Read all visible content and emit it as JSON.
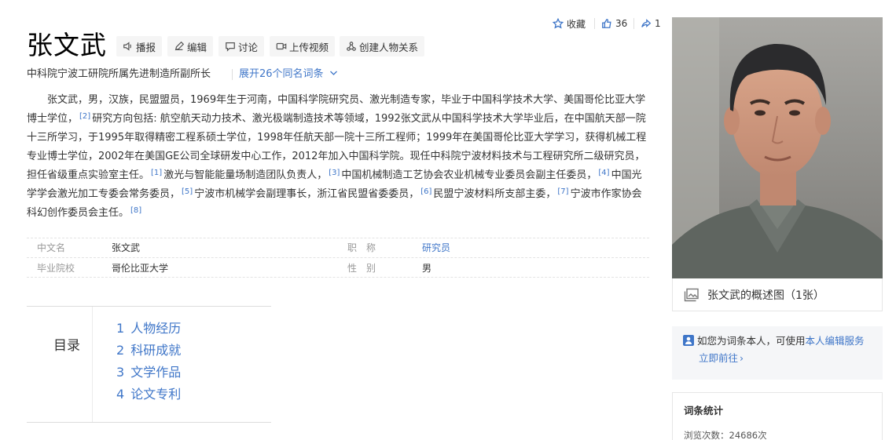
{
  "entry": {
    "title": "张文武",
    "subtitle": "中科院宁波工研院所属先进制造所副所长",
    "expand_label": "展开26个同名词条"
  },
  "toolbar": {
    "play": "播报",
    "edit": "编辑",
    "discuss": "讨论",
    "upload_video": "上传视频",
    "create_relation": "创建人物关系"
  },
  "top_actions": {
    "favorite": "收藏",
    "likes": "36",
    "shares": "1"
  },
  "summary": {
    "s1": "张文武，男，汉族，民盟盟员，1969年生于河南，中国科学院研究员、激光制造专家，毕业于中国科学技术大学、美国哥伦比亚大学博士学位，",
    "r2": "[2]",
    "s2": "研究方向包括: 航空航天动力技术、激光极端制造技术等领域，1992张文武从中国科学技术大学毕业后，在中国航天部一院十三所学习，于1995年取得精密工程系硕士学位，1998年任航天部一院十三所工程师；1999年在美国哥伦比亚大学学习，获得机械工程专业博士学位，2002年在美国GE公司全球研发中心工作，2012年加入中国科学院。现任中科院宁波材料技术与工程研究所二级研究员，担任省级重点实验室主任。",
    "r1": "[1]",
    "s3": "激光与智能能量场制造团队负责人，",
    "r3": "[3]",
    "s4": "中国机械制造工艺协会农业机械专业委员会副主任委员，",
    "r4": "[4]",
    "s5": "中国光学学会激光加工专委会常务委员，",
    "r5": "[5]",
    "s6": "宁波市机械学会副理事长，浙江省民盟省委委员，",
    "r6": "[6]",
    "s7": "民盟宁波材料所支部主委，",
    "r7": "[7]",
    "s8": "宁波市作家协会科幻创作委员会主任。",
    "r8": "[8]"
  },
  "basic_info": {
    "row1": {
      "label1": "中文名",
      "value1": "张文武",
      "label2": "职　称",
      "value2": "研究员"
    },
    "row2": {
      "label1": "毕业院校",
      "value1": "哥伦比亚大学",
      "label2": "性　别",
      "value2": "男"
    }
  },
  "toc": {
    "title": "目录",
    "items": [
      {
        "num": "1",
        "label": "人物经历"
      },
      {
        "num": "2",
        "label": "科研成就"
      },
      {
        "num": "3",
        "label": "文学作品"
      },
      {
        "num": "4",
        "label": "论文专利"
      }
    ]
  },
  "sidebar": {
    "photo_caption": "张文武的概述图（1张）",
    "notice_text": "如您为词条本人，可使用",
    "notice_link": "本人编辑服务",
    "notice_go": "立即前往",
    "notice_go_arrow": "›",
    "stats_title": "词条统计",
    "views": "浏览次数：24686次"
  },
  "colors": {
    "link": "#3f76c8",
    "toolbar_bg": "#f5f5f5"
  }
}
